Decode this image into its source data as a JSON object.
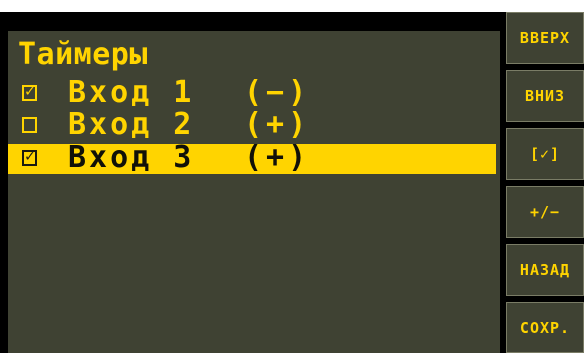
{
  "screen": {
    "title": "Таймеры"
  },
  "inputs": [
    {
      "label": "Вход 1",
      "polarity": "(−)",
      "checked": true,
      "selected": false
    },
    {
      "label": "Вход 2",
      "polarity": "(+)",
      "checked": false,
      "selected": false
    },
    {
      "label": "Вход 3",
      "polarity": "(+)",
      "checked": true,
      "selected": true
    }
  ],
  "check_glyph": "✓",
  "softkeys": {
    "up": "ВВЕРХ",
    "down": "ВНИЗ",
    "toggle": "[✓]",
    "polarity": "+/−",
    "back": "НАЗАД",
    "save": "СОХР."
  },
  "colors": {
    "accent": "#ffd400",
    "panel": "#3f4233",
    "background": "#000000"
  }
}
